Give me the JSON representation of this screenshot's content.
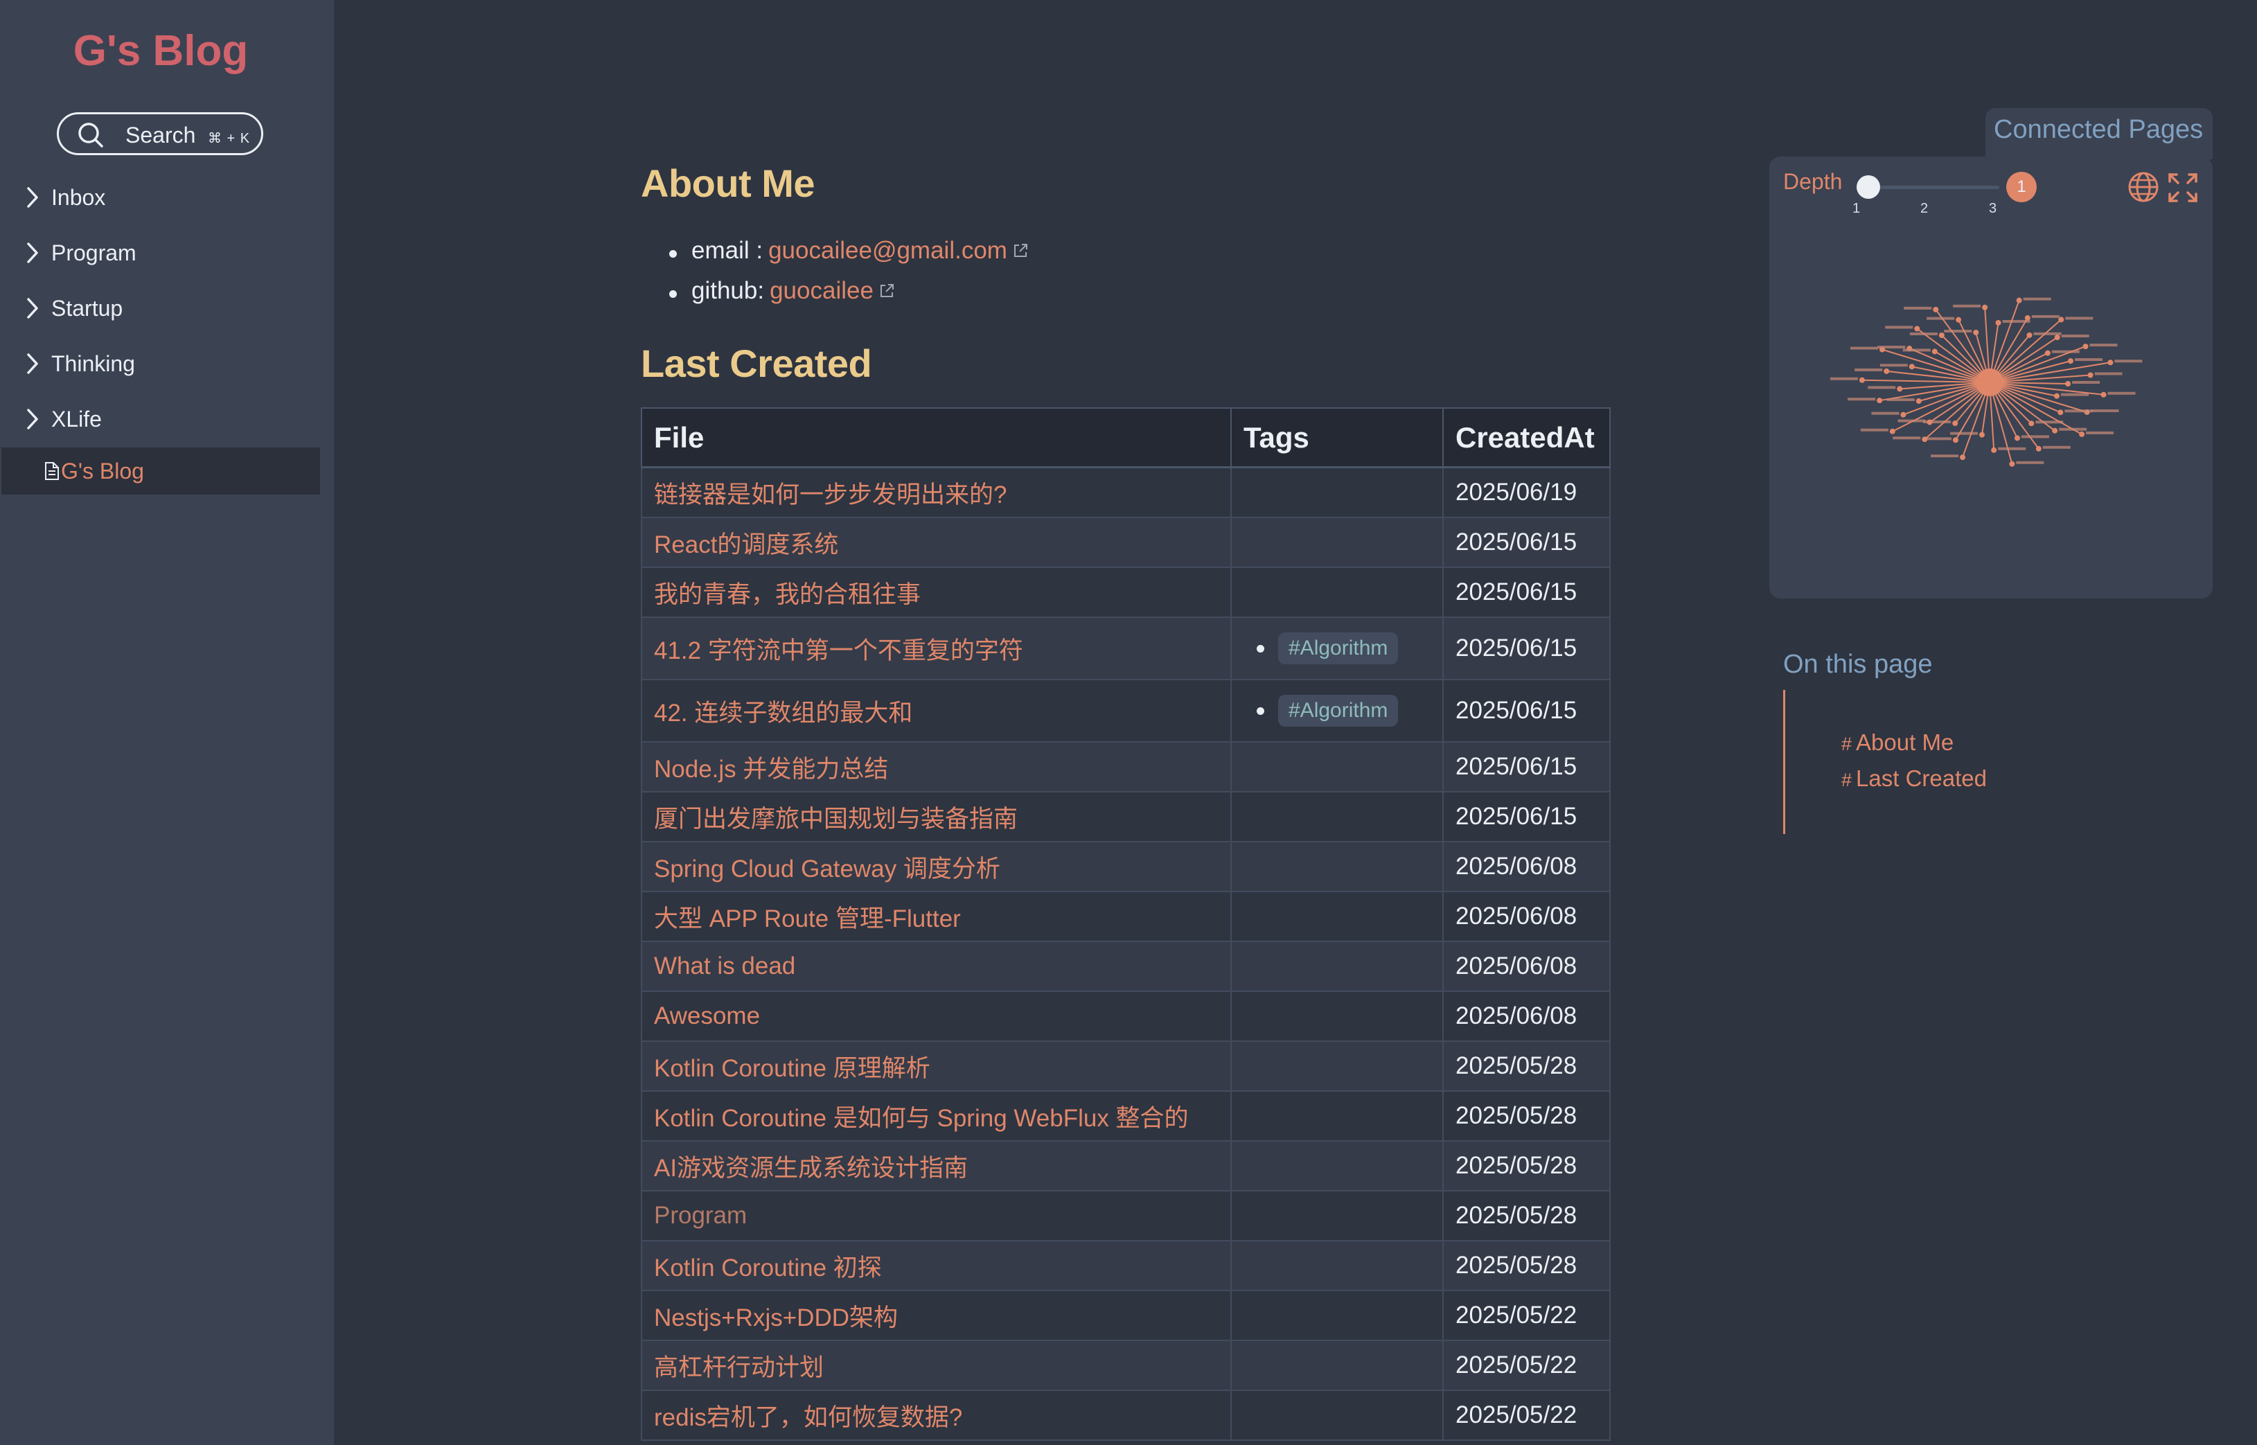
{
  "sidebar": {
    "site_title": "G's Blog",
    "search": {
      "label": "Search",
      "shortcut": "⌘ + K"
    },
    "folders": [
      {
        "label": "Inbox"
      },
      {
        "label": "Program"
      },
      {
        "label": "Startup"
      },
      {
        "label": "Thinking"
      },
      {
        "label": "XLife"
      }
    ],
    "active_page": {
      "label": "G's Blog",
      "icon": "document-icon"
    }
  },
  "main": {
    "about_heading": "About Me",
    "contacts": [
      {
        "label": "email :",
        "link_text": "guocailee@gmail.com"
      },
      {
        "label": "github:",
        "link_text": "guocailee"
      }
    ],
    "last_created_heading": "Last Created",
    "table": {
      "columns": [
        "File",
        "Tags",
        "CreatedAt"
      ],
      "rows": [
        {
          "file": "链接器是如何一步步发明出来的?",
          "tag": "",
          "date": "2025/06/19"
        },
        {
          "file": "React的调度系统",
          "tag": "",
          "date": "2025/06/15"
        },
        {
          "file": "我的青春，我的合租往事",
          "tag": "",
          "date": "2025/06/15"
        },
        {
          "file": "41.2 字符流中第一个不重复的字符",
          "tag": "#Algorithm",
          "date": "2025/06/15"
        },
        {
          "file": "42. 连续子数组的最大和",
          "tag": "#Algorithm",
          "date": "2025/06/15"
        },
        {
          "file": "Node.js 并发能力总结",
          "tag": "",
          "date": "2025/06/15"
        },
        {
          "file": "厦门出发摩旅中国规划与装备指南",
          "tag": "",
          "date": "2025/06/15"
        },
        {
          "file": "Spring Cloud Gateway 调度分析",
          "tag": "",
          "date": "2025/06/08"
        },
        {
          "file": "大型 APP Route 管理-Flutter",
          "tag": "",
          "date": "2025/06/08"
        },
        {
          "file": "What is dead",
          "tag": "",
          "date": "2025/06/08"
        },
        {
          "file": "Awesome",
          "tag": "",
          "date": "2025/06/08"
        },
        {
          "file": "Kotlin Coroutine 原理解析",
          "tag": "",
          "date": "2025/05/28"
        },
        {
          "file": "Kotlin Coroutine 是如何与 Spring WebFlux 整合的",
          "tag": "",
          "date": "2025/05/28"
        },
        {
          "file": "AI游戏资源生成系统设计指南",
          "tag": "",
          "date": "2025/05/28"
        },
        {
          "file": "Program",
          "tag": "",
          "date": "2025/05/28"
        },
        {
          "file": "Kotlin Coroutine 初探",
          "tag": "",
          "date": "2025/05/28"
        },
        {
          "file": "Nestjs+Rxjs+DDD架构",
          "tag": "",
          "date": "2025/05/22"
        },
        {
          "file": "高杠杆行动计划",
          "tag": "",
          "date": "2025/05/22"
        },
        {
          "file": "redis宕机了，如何恢复数据?",
          "tag": "",
          "date": "2025/05/22"
        }
      ]
    }
  },
  "graph": {
    "title": "Connected Pages",
    "depth_label": "Depth",
    "depth_value": "1",
    "depth_ticks": [
      "1",
      "2",
      "3"
    ],
    "icons": [
      "globe-icon",
      "expand-icon"
    ]
  },
  "toc": {
    "title": "On this page",
    "items": [
      {
        "hash": "#",
        "label": "About Me"
      },
      {
        "hash": "#",
        "label": "Last Created"
      }
    ]
  },
  "colors": {
    "accent": "#e0876a",
    "title": "#d0636b",
    "heading": "#ebcb8b",
    "link_blue": "#81a1c1",
    "background": "#2e3440",
    "sidebar": "#3b4252"
  }
}
